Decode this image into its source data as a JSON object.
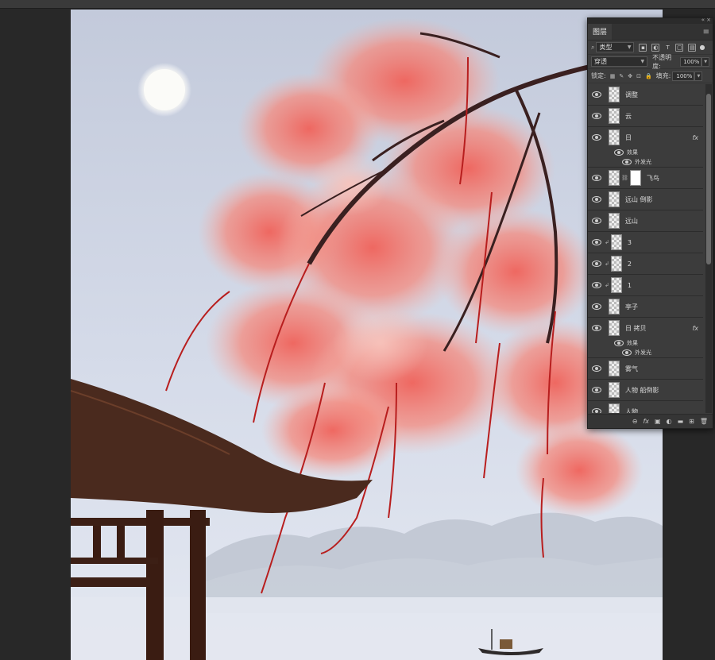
{
  "panel": {
    "tab_label": "图层",
    "filter_kind": "类型",
    "blend_mode": "穿透",
    "opacity_label": "不透明度:",
    "opacity_value": "100%",
    "lock_label": "锁定:",
    "fill_label": "填充:",
    "fill_value": "100%"
  },
  "layers": [
    {
      "name": "调整",
      "fx": ""
    },
    {
      "name": "云",
      "fx": ""
    },
    {
      "name": "日",
      "fx": "fx",
      "effects_label": "效果",
      "effect": "外发光"
    },
    {
      "name": "飞鸟",
      "fx": "",
      "mask": true
    },
    {
      "name": "远山 倒影",
      "fx": ""
    },
    {
      "name": "远山",
      "fx": ""
    },
    {
      "name": "3",
      "fx": "",
      "clipped": true
    },
    {
      "name": "2",
      "fx": "",
      "clipped": true
    },
    {
      "name": "1",
      "fx": "",
      "clipped": true
    },
    {
      "name": "亭子",
      "fx": ""
    },
    {
      "name": "日 拷贝",
      "fx": "fx",
      "effects_label": "效果",
      "effect": "外发光"
    },
    {
      "name": "雾气",
      "fx": ""
    },
    {
      "name": "人物 船倒影",
      "fx": ""
    },
    {
      "name": "人物",
      "fx": ""
    }
  ],
  "bottom_icons": [
    "link-icon",
    "fx-icon",
    "mask-icon",
    "adjustment-icon",
    "folder-icon",
    "new-layer-icon",
    "trash-icon"
  ],
  "bottom_glyphs": [
    "⊖",
    "fx",
    "▣",
    "◐",
    "▬",
    "⊞",
    "🗑"
  ],
  "colors": {
    "canvas_bg": "#282828",
    "panel_bg": "#3c3c3c",
    "sky": "#c9d1e2",
    "blossom": "#f07a6e",
    "pavilion": "#4a2a1e"
  }
}
